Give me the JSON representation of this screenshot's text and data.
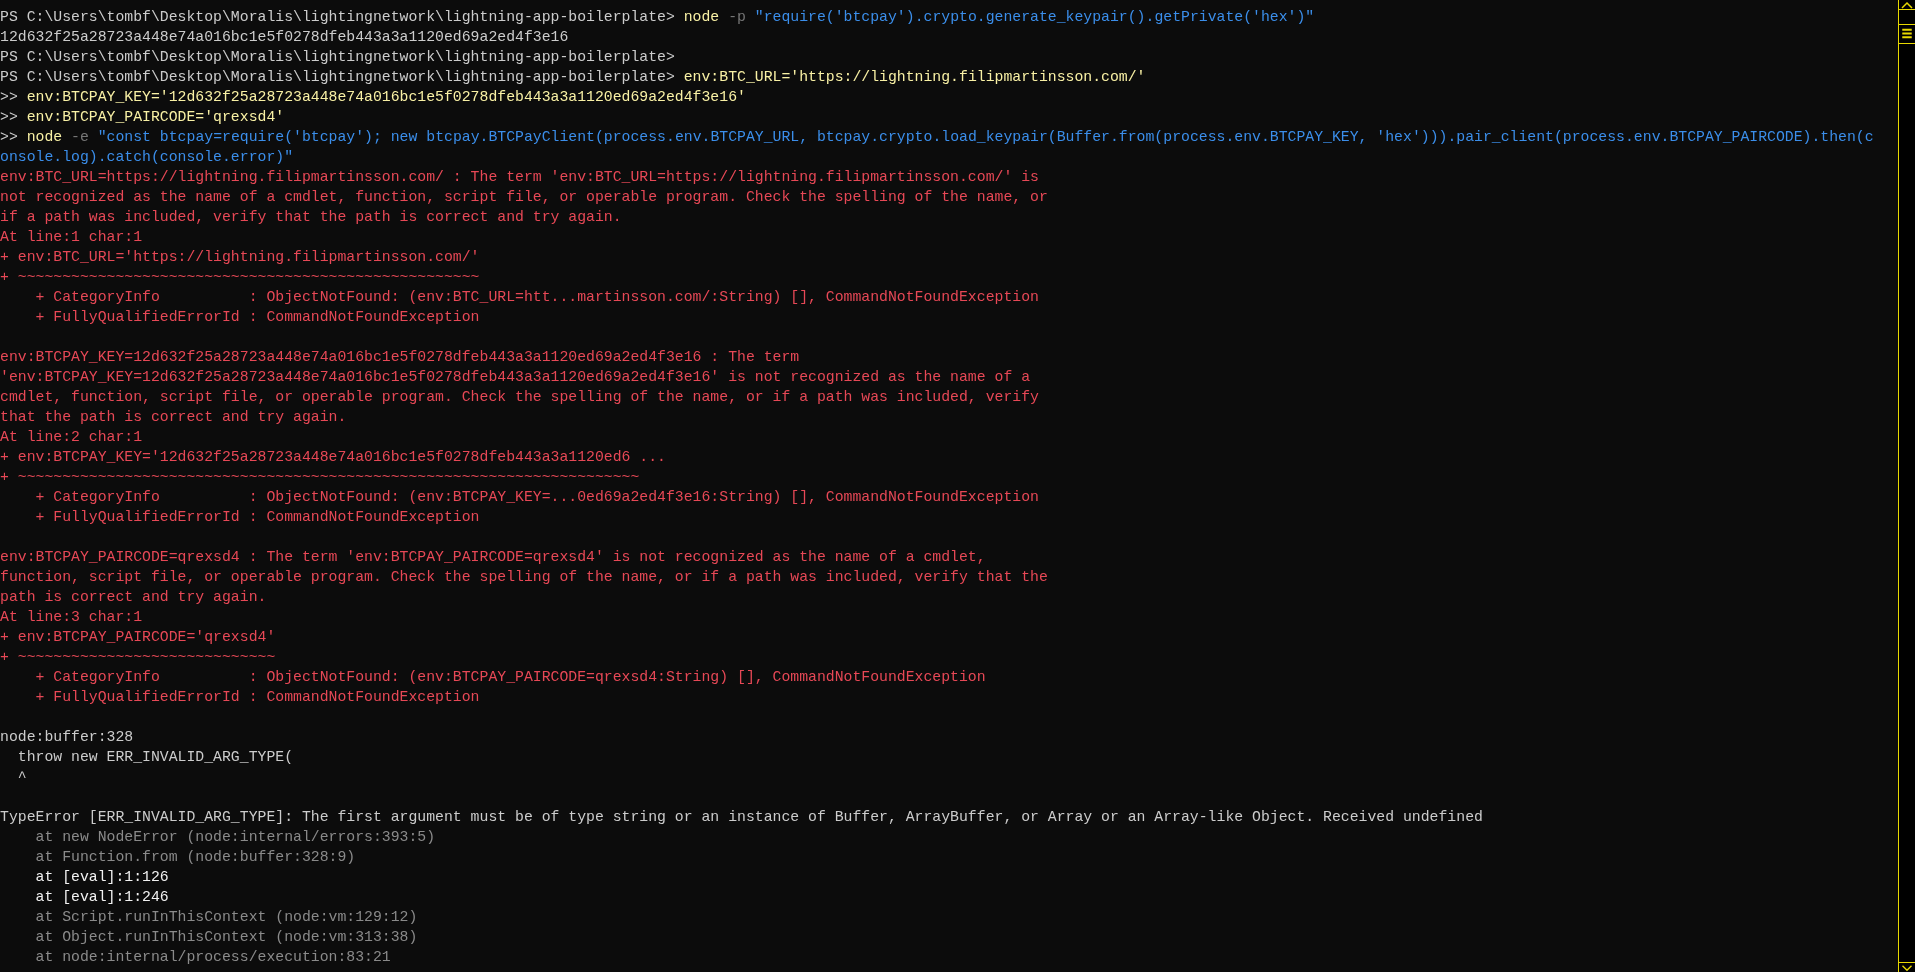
{
  "terminal": {
    "lines": [
      {
        "kind": "text",
        "segments": [
          {
            "kind": "output",
            "text": "PS C:\\Users\\tombf\\Desktop\\Moralis\\lightingnetwork\\lightning-app-boilerplate> "
          },
          {
            "kind": "command",
            "text": "node"
          },
          {
            "kind": "flag",
            "text": " -p "
          },
          {
            "kind": "string",
            "text": "\"require('btcpay').crypto.generate_keypair().getPrivate('hex')\""
          }
        ]
      },
      {
        "kind": "text",
        "segments": [
          {
            "kind": "output",
            "text": "12d632f25a28723a448e74a016bc1e5f0278dfeb443a3a1120ed69a2ed4f3e16"
          }
        ]
      },
      {
        "kind": "text",
        "segments": [
          {
            "kind": "output",
            "text": "PS C:\\Users\\tombf\\Desktop\\Moralis\\lightingnetwork\\lightning-app-boilerplate>"
          }
        ]
      },
      {
        "kind": "text",
        "segments": [
          {
            "kind": "output",
            "text": "PS C:\\Users\\tombf\\Desktop\\Moralis\\lightingnetwork\\lightning-app-boilerplate> "
          },
          {
            "kind": "command",
            "text": "env:BTC_URL='https://lightning.filipmartinsson.com/'"
          }
        ]
      },
      {
        "kind": "text",
        "segments": [
          {
            "kind": "output",
            "text": ">> "
          },
          {
            "kind": "command",
            "text": "env:BTCPAY_KEY='12d632f25a28723a448e74a016bc1e5f0278dfeb443a3a1120ed69a2ed4f3e16'"
          }
        ]
      },
      {
        "kind": "text",
        "segments": [
          {
            "kind": "output",
            "text": ">> "
          },
          {
            "kind": "command",
            "text": "env:BTCPAY_PAIRCODE='qrexsd4'"
          }
        ]
      },
      {
        "kind": "text",
        "segments": [
          {
            "kind": "output",
            "text": ">> "
          },
          {
            "kind": "command",
            "text": "node"
          },
          {
            "kind": "flag",
            "text": " -e "
          },
          {
            "kind": "string",
            "text": "\"const btcpay=require('btcpay'); new btcpay.BTCPayClient(process.env.BTCPAY_URL, btcpay.crypto.load_keypair(Buffer.from(process.env.BTCPAY_KEY, 'hex'))).pair_client(process.env.BTCPAY_PAIRCODE).then(c"
          }
        ]
      },
      {
        "kind": "text",
        "segments": [
          {
            "kind": "string",
            "text": "onsole.log).catch(console.error)\""
          }
        ]
      },
      {
        "kind": "text",
        "segments": [
          {
            "kind": "error",
            "text": "env:BTC_URL=https://lightning.filipmartinsson.com/ : The term 'env:BTC_URL=https://lightning.filipmartinsson.com/' is"
          }
        ]
      },
      {
        "kind": "text",
        "segments": [
          {
            "kind": "error",
            "text": "not recognized as the name of a cmdlet, function, script file, or operable program. Check the spelling of the name, or"
          }
        ]
      },
      {
        "kind": "text",
        "segments": [
          {
            "kind": "error",
            "text": "if a path was included, verify that the path is correct and try again."
          }
        ]
      },
      {
        "kind": "text",
        "segments": [
          {
            "kind": "error",
            "text": "At line:1 char:1"
          }
        ]
      },
      {
        "kind": "text",
        "segments": [
          {
            "kind": "error",
            "text": "+ env:BTC_URL='https://lightning.filipmartinsson.com/'"
          }
        ]
      },
      {
        "kind": "text",
        "segments": [
          {
            "kind": "error",
            "text": "+ ~~~~~~~~~~~~~~~~~~~~~~~~~~~~~~~~~~~~~~~~~~~~~~~~~~~~"
          }
        ]
      },
      {
        "kind": "text",
        "segments": [
          {
            "kind": "error",
            "text": "    + CategoryInfo          : ObjectNotFound: (env:BTC_URL=htt...martinsson.com/:String) [], CommandNotFoundException"
          }
        ]
      },
      {
        "kind": "text",
        "segments": [
          {
            "kind": "error",
            "text": "    + FullyQualifiedErrorId : CommandNotFoundException"
          }
        ]
      },
      {
        "kind": "blank"
      },
      {
        "kind": "text",
        "segments": [
          {
            "kind": "error",
            "text": "env:BTCPAY_KEY=12d632f25a28723a448e74a016bc1e5f0278dfeb443a3a1120ed69a2ed4f3e16 : The term"
          }
        ]
      },
      {
        "kind": "text",
        "segments": [
          {
            "kind": "error",
            "text": "'env:BTCPAY_KEY=12d632f25a28723a448e74a016bc1e5f0278dfeb443a3a1120ed69a2ed4f3e16' is not recognized as the name of a"
          }
        ]
      },
      {
        "kind": "text",
        "segments": [
          {
            "kind": "error",
            "text": "cmdlet, function, script file, or operable program. Check the spelling of the name, or if a path was included, verify"
          }
        ]
      },
      {
        "kind": "text",
        "segments": [
          {
            "kind": "error",
            "text": "that the path is correct and try again."
          }
        ]
      },
      {
        "kind": "text",
        "segments": [
          {
            "kind": "error",
            "text": "At line:2 char:1"
          }
        ]
      },
      {
        "kind": "text",
        "segments": [
          {
            "kind": "error",
            "text": "+ env:BTCPAY_KEY='12d632f25a28723a448e74a016bc1e5f0278dfeb443a3a1120ed6 ..."
          }
        ]
      },
      {
        "kind": "text",
        "segments": [
          {
            "kind": "error",
            "text": "+ ~~~~~~~~~~~~~~~~~~~~~~~~~~~~~~~~~~~~~~~~~~~~~~~~~~~~~~~~~~~~~~~~~~~~~~"
          }
        ]
      },
      {
        "kind": "text",
        "segments": [
          {
            "kind": "error",
            "text": "    + CategoryInfo          : ObjectNotFound: (env:BTCPAY_KEY=...0ed69a2ed4f3e16:String) [], CommandNotFoundException"
          }
        ]
      },
      {
        "kind": "text",
        "segments": [
          {
            "kind": "error",
            "text": "    + FullyQualifiedErrorId : CommandNotFoundException"
          }
        ]
      },
      {
        "kind": "blank"
      },
      {
        "kind": "text",
        "segments": [
          {
            "kind": "error",
            "text": "env:BTCPAY_PAIRCODE=qrexsd4 : The term 'env:BTCPAY_PAIRCODE=qrexsd4' is not recognized as the name of a cmdlet,"
          }
        ]
      },
      {
        "kind": "text",
        "segments": [
          {
            "kind": "error",
            "text": "function, script file, or operable program. Check the spelling of the name, or if a path was included, verify that the"
          }
        ]
      },
      {
        "kind": "text",
        "segments": [
          {
            "kind": "error",
            "text": "path is correct and try again."
          }
        ]
      },
      {
        "kind": "text",
        "segments": [
          {
            "kind": "error",
            "text": "At line:3 char:1"
          }
        ]
      },
      {
        "kind": "text",
        "segments": [
          {
            "kind": "error",
            "text": "+ env:BTCPAY_PAIRCODE='qrexsd4'"
          }
        ]
      },
      {
        "kind": "text",
        "segments": [
          {
            "kind": "error",
            "text": "+ ~~~~~~~~~~~~~~~~~~~~~~~~~~~~~"
          }
        ]
      },
      {
        "kind": "text",
        "segments": [
          {
            "kind": "error",
            "text": "    + CategoryInfo          : ObjectNotFound: (env:BTCPAY_PAIRCODE=qrexsd4:String) [], CommandNotFoundException"
          }
        ]
      },
      {
        "kind": "text",
        "segments": [
          {
            "kind": "error",
            "text": "    + FullyQualifiedErrorId : CommandNotFoundException"
          }
        ]
      },
      {
        "kind": "blank"
      },
      {
        "kind": "text",
        "segments": [
          {
            "kind": "output",
            "text": "node:buffer:328"
          }
        ]
      },
      {
        "kind": "text",
        "segments": [
          {
            "kind": "output",
            "text": "  throw new ERR_INVALID_ARG_TYPE("
          }
        ]
      },
      {
        "kind": "text",
        "segments": [
          {
            "kind": "output",
            "text": "  ^"
          }
        ]
      },
      {
        "kind": "blank"
      },
      {
        "kind": "text",
        "segments": [
          {
            "kind": "output",
            "text": "TypeError [ERR_INVALID_ARG_TYPE]: The first argument must be of type string or an instance of Buffer, ArrayBuffer, or Array or an Array-like Object. Received undefined"
          }
        ]
      },
      {
        "kind": "text",
        "segments": [
          {
            "kind": "stack",
            "text": "    at new NodeError (node:internal/errors:393:5)"
          }
        ]
      },
      {
        "kind": "text",
        "segments": [
          {
            "kind": "stack",
            "text": "    at Function.from (node:buffer:328:9)"
          }
        ]
      },
      {
        "kind": "text",
        "segments": [
          {
            "kind": "stack_user",
            "text": "    at [eval]:1:126"
          }
        ]
      },
      {
        "kind": "text",
        "segments": [
          {
            "kind": "stack_user",
            "text": "    at [eval]:1:246"
          }
        ]
      },
      {
        "kind": "text",
        "segments": [
          {
            "kind": "stack",
            "text": "    at Script.runInThisContext (node:vm:129:12)"
          }
        ]
      },
      {
        "kind": "text",
        "segments": [
          {
            "kind": "stack",
            "text": "    at Object.runInThisContext (node:vm:313:38)"
          }
        ]
      },
      {
        "kind": "text",
        "segments": [
          {
            "kind": "stack",
            "text": "    at node:internal/process/execution:83:21"
          }
        ]
      }
    ]
  }
}
